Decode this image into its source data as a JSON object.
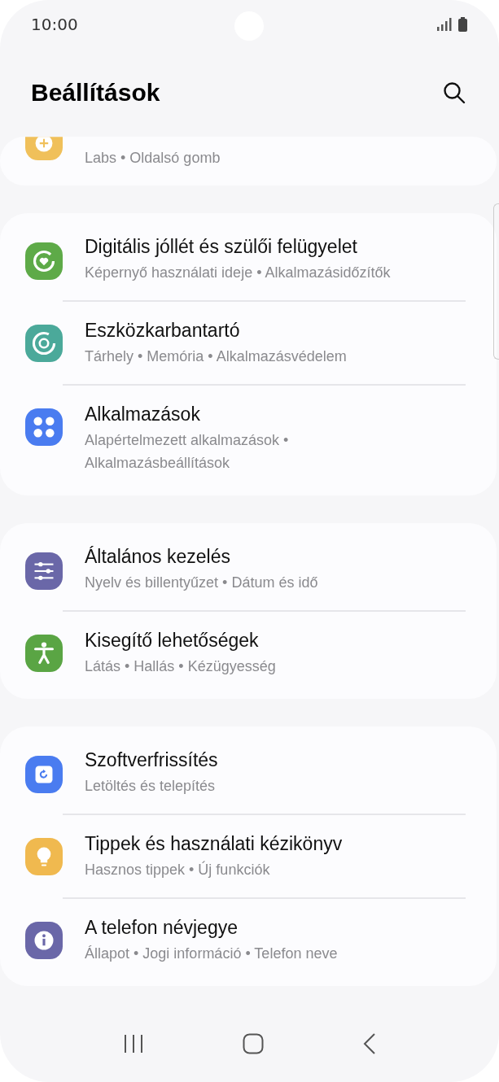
{
  "status_bar": {
    "time": "10:00"
  },
  "header": {
    "title": "Beállítások"
  },
  "partial_item": {
    "subtitle": "Labs • Oldalsó gomb"
  },
  "groups": [
    {
      "items": [
        {
          "title": "Digitális jóllét és szülői felügyelet",
          "subtitle": "Képernyő használati ideje • Alkalmazásidőzítők"
        },
        {
          "title": "Eszközkarbantartó",
          "subtitle": "Tárhely • Memória • Alkalmazásvédelem"
        },
        {
          "title": "Alkalmazások",
          "subtitle": "Alapértelmezett alkalmazások • Alkalmazásbeállítások"
        }
      ]
    },
    {
      "items": [
        {
          "title": "Általános kezelés",
          "subtitle": "Nyelv és billentyűzet • Dátum és idő"
        },
        {
          "title": "Kisegítő lehetőségek",
          "subtitle": "Látás • Hallás • Kézügyesség"
        }
      ]
    },
    {
      "items": [
        {
          "title": "Szoftverfrissítés",
          "subtitle": "Letöltés és telepítés"
        },
        {
          "title": "Tippek és használati kézikönyv",
          "subtitle": "Hasznos tippek • Új funkciók"
        },
        {
          "title": "A telefon névjegye",
          "subtitle": "Állapot • Jogi információ • Telefon neve"
        }
      ]
    }
  ]
}
